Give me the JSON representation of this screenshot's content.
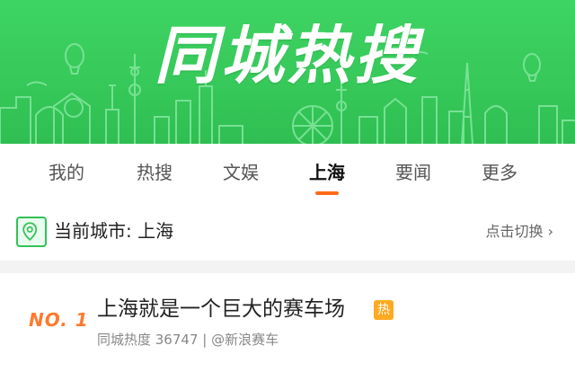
{
  "banner": {
    "title": "同城热搜"
  },
  "tabs": [
    {
      "label": "我的",
      "active": false
    },
    {
      "label": "热搜",
      "active": false
    },
    {
      "label": "文娱",
      "active": false
    },
    {
      "label": "上海",
      "active": true
    },
    {
      "label": "要闻",
      "active": false
    },
    {
      "label": "更多",
      "active": false
    }
  ],
  "city": {
    "label": "当前城市: 上海",
    "switch_label": "点击切换 ›"
  },
  "list": [
    {
      "rank": "NO. 1",
      "title": "上海就是一个巨大的赛车场",
      "badge": "热",
      "meta": "同城热度 36747 | @新浪赛车"
    }
  ],
  "colors": {
    "banner_green": "#37c95a",
    "accent_orange": "#ff6a1a",
    "hot_badge": "#ffaa22"
  }
}
